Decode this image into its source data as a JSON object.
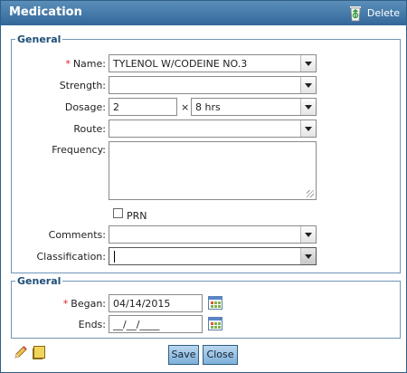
{
  "window": {
    "title": "Medication",
    "delete_label": "Delete"
  },
  "general": {
    "legend": "General",
    "name": {
      "label": "Name:",
      "required": "*",
      "value": "TYLENOL W/CODEINE NO.3"
    },
    "strength": {
      "label": "Strength:",
      "value": ""
    },
    "dosage": {
      "label": "Dosage:",
      "amount": "2",
      "times": "×",
      "interval": "8 hrs"
    },
    "route": {
      "label": "Route:",
      "value": ""
    },
    "frequency": {
      "label": "Frequency:",
      "value": ""
    },
    "prn": {
      "label": "PRN",
      "checked": false
    },
    "comments": {
      "label": "Comments:",
      "value": ""
    },
    "classification": {
      "label": "Classification:",
      "value": ""
    }
  },
  "dates": {
    "legend": "General",
    "began": {
      "label": "Began:",
      "required": "*",
      "value": "04/14/2015"
    },
    "ends": {
      "label": "Ends:",
      "value": "__/__/____"
    }
  },
  "footer": {
    "save_label": "Save",
    "close_label": "Close"
  },
  "icons": {
    "delete": "recycle-bin-icon",
    "edit": "pencil-icon",
    "notes": "sticky-note-icon",
    "calendar": "calendar-icon"
  }
}
